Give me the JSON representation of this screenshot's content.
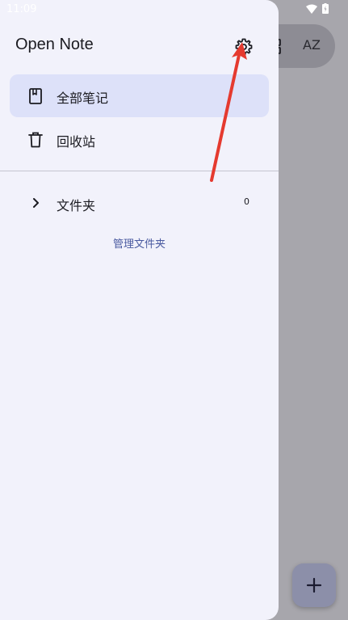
{
  "status_bar": {
    "time": "11:09"
  },
  "drawer": {
    "title": "Open Note",
    "settings_icon": "gear-icon",
    "items": [
      {
        "label": "全部笔记",
        "icon": "notebook-icon",
        "active": true
      },
      {
        "label": "回收站",
        "icon": "trash-icon",
        "active": false
      }
    ],
    "folders": {
      "label": "文件夹",
      "count": "0",
      "manage_label": "管理文件夹"
    }
  },
  "background_app": {
    "sort_label": "AZ",
    "fab_icon": "plus-icon"
  },
  "colors": {
    "drawer_bg": "#f2f2fb",
    "active_item_bg": "#dde1f9",
    "scrim": "#a7a6ac",
    "accent_link": "#4a5aa0",
    "annotation_arrow": "#e53a2f"
  }
}
